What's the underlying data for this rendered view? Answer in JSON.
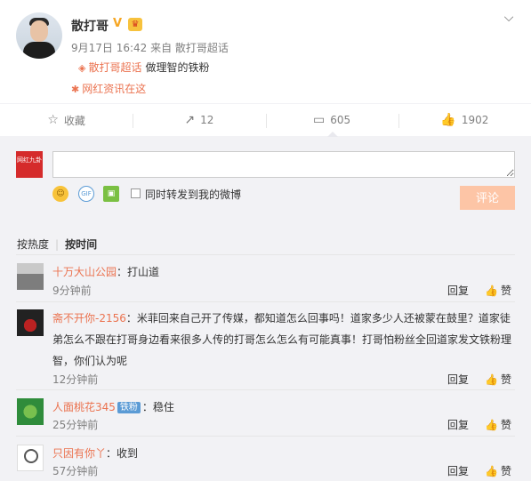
{
  "post": {
    "username": "散打哥",
    "v_badge": "V",
    "meta": "9月17日 16:42 来自 散打哥超话",
    "tag_link": "散打哥超话",
    "tag_text": "做理智的铁粉",
    "source_link": "网红资讯在这",
    "chevron": "⌵"
  },
  "actions": {
    "favorite": {
      "icon": "☆",
      "label": "收藏"
    },
    "repost": {
      "icon": "↗",
      "label": "12"
    },
    "comment": {
      "icon": "▭",
      "label": "605"
    },
    "like": {
      "icon": "👍",
      "label": "1902"
    }
  },
  "composer": {
    "avatar_text": "网红九卦",
    "input_value": "",
    "emoji_icon": "☺",
    "gif_icon": "GIF",
    "pic_icon": "▣",
    "repost_label": "同时转发到我的微博",
    "submit_label": "评论"
  },
  "sort": {
    "by_heat": "按热度",
    "separator": "|",
    "by_time": "按时间"
  },
  "comments": [
    {
      "user": "十万大山公园",
      "text": "：打山道",
      "time": "9分钟前",
      "reply": "回复",
      "like": "赞"
    },
    {
      "user": "斋不开你-2156",
      "text": "：米菲回来自己开了传媒，都知道怎么回事吗！道家多少人还被蒙在鼓里？道家徒弟怎么不跟在打哥身边看来很多人传的打哥怎么怎么有可能真事！打哥怕粉丝全回道家发文铁粉理智，你们认为呢",
      "time": "12分钟前",
      "reply": "回复",
      "like": "赞"
    },
    {
      "user": "人面桃花345",
      "badge": "铁粉",
      "text": "：稳住",
      "time": "25分钟前",
      "reply": "回复",
      "like": "赞"
    },
    {
      "user": "只因有你丫",
      "text": "：收到",
      "time": "57分钟前",
      "reply": "回复",
      "like": "赞"
    }
  ]
}
